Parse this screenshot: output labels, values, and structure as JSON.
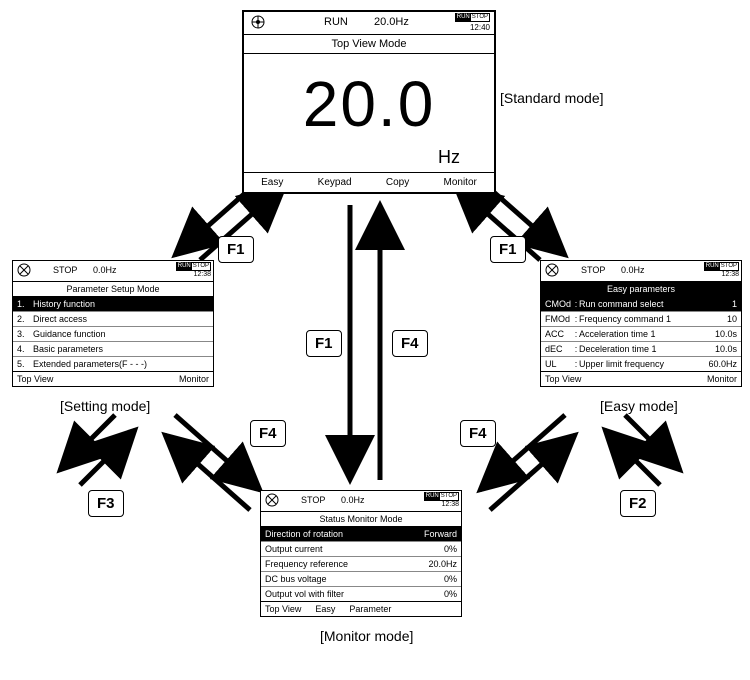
{
  "topview": {
    "status": "RUN",
    "hz": "20.0Hz",
    "time": "12:40",
    "title": "Top View Mode",
    "value": "20.0",
    "unit": "Hz",
    "foot": [
      "Easy",
      "Keypad",
      "Copy",
      "Monitor"
    ]
  },
  "standard_label": "[Standard mode]",
  "setting": {
    "status": "STOP",
    "hz": "0.0Hz",
    "time": "12:38",
    "title": "Parameter Setup Mode",
    "rows": [
      {
        "n": "1.",
        "t": "History function",
        "sel": true
      },
      {
        "n": "2.",
        "t": "Direct access"
      },
      {
        "n": "3.",
        "t": "Guidance function"
      },
      {
        "n": "4.",
        "t": "Basic parameters"
      },
      {
        "n": "5.",
        "t": "Extended parameters(F - - -)"
      }
    ],
    "footL": "Top View",
    "footR": "Monitor",
    "label": "[Setting mode]"
  },
  "easy": {
    "status": "STOP",
    "hz": "0.0Hz",
    "time": "12:38",
    "title": "Easy parameters",
    "rows": [
      {
        "k": "CMOd",
        "t": "Run command select",
        "v": "1",
        "sel": true
      },
      {
        "k": "FMOd",
        "t": "Frequency command 1",
        "v": "10"
      },
      {
        "k": "ACC",
        "t": "Acceleration time 1",
        "v": "10.0s"
      },
      {
        "k": "dEC",
        "t": "Deceleration time 1",
        "v": "10.0s"
      },
      {
        "k": "UL",
        "t": "Upper limit frequency",
        "v": "60.0Hz"
      }
    ],
    "footL": "Top View",
    "footR": "Monitor",
    "label": "[Easy mode]"
  },
  "monitor": {
    "status": "STOP",
    "hz": "0.0Hz",
    "time": "12:38",
    "title": "Status Monitor Mode",
    "rows": [
      {
        "t": "Direction of rotation",
        "v": "Forward",
        "sel": true
      },
      {
        "t": "Output current",
        "v": "0%"
      },
      {
        "t": "Frequency reference",
        "v": "20.0Hz"
      },
      {
        "t": "DC bus voltage",
        "v": "0%"
      },
      {
        "t": "Output vol with filter",
        "v": "0%"
      }
    ],
    "foot": [
      "Top View",
      "Easy",
      "Parameter"
    ],
    "label": "[Monitor mode]"
  },
  "fkeys": {
    "a": "F1",
    "b": "F1",
    "c": "F1",
    "d": "F4",
    "e": "F4",
    "f": "F4",
    "g": "F3",
    "h": "F2"
  }
}
